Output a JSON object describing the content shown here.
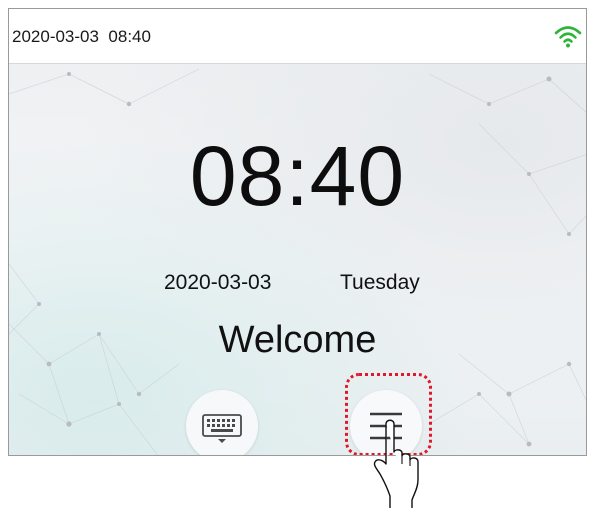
{
  "status_bar": {
    "datetime": "2020-03-03  08:40",
    "wifi_icon": "wifi-icon",
    "wifi_color": "#2fb43a"
  },
  "main": {
    "clock": "08:40",
    "date": "2020-03-03",
    "weekday": "Tuesday",
    "welcome": "Welcome"
  },
  "buttons": {
    "keyboard_icon": "keyboard-icon",
    "menu_icon": "menu-icon"
  },
  "annotation": {
    "highlight_color": "#e0182b",
    "pointer_icon": "hand-pointer-icon"
  }
}
